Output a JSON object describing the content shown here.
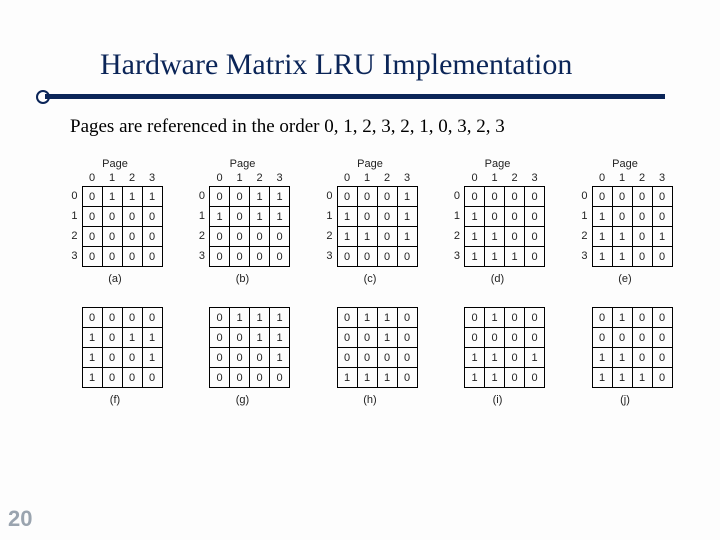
{
  "title": "Hardware Matrix LRU Implementation",
  "subtitle": "Pages are referenced in the order 0, 1, 2, 3, 2, 1, 0, 3, 2, 3",
  "page_number": "20",
  "page_header": "Page",
  "col_labels": [
    "0",
    "1",
    "2",
    "3"
  ],
  "row_labels": [
    "0",
    "1",
    "2",
    "3"
  ],
  "matrices_top": [
    {
      "caption": "(a)",
      "rows": [
        [
          "0",
          "1",
          "1",
          "1"
        ],
        [
          "0",
          "0",
          "0",
          "0"
        ],
        [
          "0",
          "0",
          "0",
          "0"
        ],
        [
          "0",
          "0",
          "0",
          "0"
        ]
      ]
    },
    {
      "caption": "(b)",
      "rows": [
        [
          "0",
          "0",
          "1",
          "1"
        ],
        [
          "1",
          "0",
          "1",
          "1"
        ],
        [
          "0",
          "0",
          "0",
          "0"
        ],
        [
          "0",
          "0",
          "0",
          "0"
        ]
      ]
    },
    {
      "caption": "(c)",
      "rows": [
        [
          "0",
          "0",
          "0",
          "1"
        ],
        [
          "1",
          "0",
          "0",
          "1"
        ],
        [
          "1",
          "1",
          "0",
          "1"
        ],
        [
          "0",
          "0",
          "0",
          "0"
        ]
      ]
    },
    {
      "caption": "(d)",
      "rows": [
        [
          "0",
          "0",
          "0",
          "0"
        ],
        [
          "1",
          "0",
          "0",
          "0"
        ],
        [
          "1",
          "1",
          "0",
          "0"
        ],
        [
          "1",
          "1",
          "1",
          "0"
        ]
      ]
    },
    {
      "caption": "(e)",
      "rows": [
        [
          "0",
          "0",
          "0",
          "0"
        ],
        [
          "1",
          "0",
          "0",
          "0"
        ],
        [
          "1",
          "1",
          "0",
          "1"
        ],
        [
          "1",
          "1",
          "0",
          "0"
        ]
      ]
    }
  ],
  "matrices_bottom": [
    {
      "caption": "(f)",
      "rows": [
        [
          "0",
          "0",
          "0",
          "0"
        ],
        [
          "1",
          "0",
          "1",
          "1"
        ],
        [
          "1",
          "0",
          "0",
          "1"
        ],
        [
          "1",
          "0",
          "0",
          "0"
        ]
      ]
    },
    {
      "caption": "(g)",
      "rows": [
        [
          "0",
          "1",
          "1",
          "1"
        ],
        [
          "0",
          "0",
          "1",
          "1"
        ],
        [
          "0",
          "0",
          "0",
          "1"
        ],
        [
          "0",
          "0",
          "0",
          "0"
        ]
      ]
    },
    {
      "caption": "(h)",
      "rows": [
        [
          "0",
          "1",
          "1",
          "0"
        ],
        [
          "0",
          "0",
          "1",
          "0"
        ],
        [
          "0",
          "0",
          "0",
          "0"
        ],
        [
          "1",
          "1",
          "1",
          "0"
        ]
      ]
    },
    {
      "caption": "(i)",
      "rows": [
        [
          "0",
          "1",
          "0",
          "0"
        ],
        [
          "0",
          "0",
          "0",
          "0"
        ],
        [
          "1",
          "1",
          "0",
          "1"
        ],
        [
          "1",
          "1",
          "0",
          "0"
        ]
      ]
    },
    {
      "caption": "(j)",
      "rows": [
        [
          "0",
          "1",
          "0",
          "0"
        ],
        [
          "0",
          "0",
          "0",
          "0"
        ],
        [
          "1",
          "1",
          "0",
          "0"
        ],
        [
          "1",
          "1",
          "1",
          "0"
        ]
      ]
    }
  ]
}
